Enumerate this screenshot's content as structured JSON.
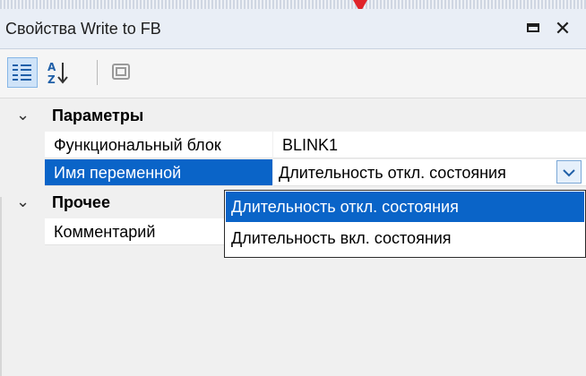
{
  "window": {
    "title": "Свойства Write to FB"
  },
  "toolbar": {
    "buttons": [
      {
        "icon": "categorized-icon"
      },
      {
        "icon": "sort-az-icon"
      },
      {
        "icon": "property-pages-icon"
      }
    ]
  },
  "grid": {
    "categories": [
      {
        "label": "Параметры",
        "expanded": true,
        "properties": [
          {
            "name": "Функциональный блок",
            "value": "BLINK1"
          },
          {
            "name": "Имя переменной",
            "value": "Длительность откл. состояния",
            "selected": true
          }
        ]
      },
      {
        "label": "Прочее",
        "expanded": true,
        "properties": [
          {
            "name": "Комментарий",
            "value": ""
          }
        ]
      }
    ]
  },
  "dropdown": {
    "options": [
      "Длительность откл. состояния",
      "Длительность вкл. состояния"
    ],
    "highlighted_index": 0
  },
  "colors": {
    "selection": "#0a64c8",
    "title_bar": "#e9eef6",
    "accent_marker": "#e0242a"
  }
}
